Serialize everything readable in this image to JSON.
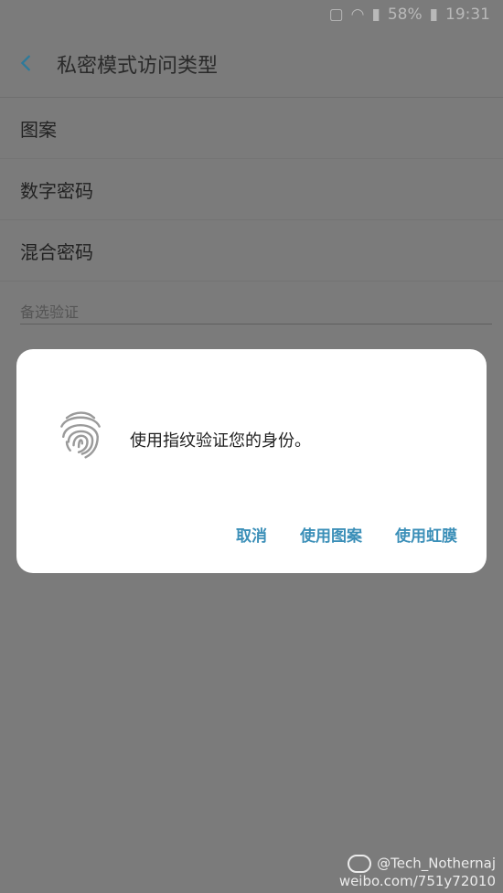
{
  "status_bar": {
    "battery_percent": "58%",
    "time": "19:31"
  },
  "appbar": {
    "title": "私密模式访问类型"
  },
  "list": {
    "items": [
      "图案",
      "数字密码",
      "混合密码"
    ],
    "section_header": "备选验证"
  },
  "dialog": {
    "message": "使用指纹验证您的身份。",
    "buttons": {
      "cancel": "取消",
      "use_pattern": "使用图案",
      "use_iris": "使用虹膜"
    }
  },
  "watermark": {
    "handle": "@Tech_Nothernaj",
    "url": "weibo.com/751y72010"
  },
  "colors": {
    "dim_overlay": "#7b7b7b",
    "accent": "#3b8fb8",
    "dialog_bg": "#ffffff"
  }
}
